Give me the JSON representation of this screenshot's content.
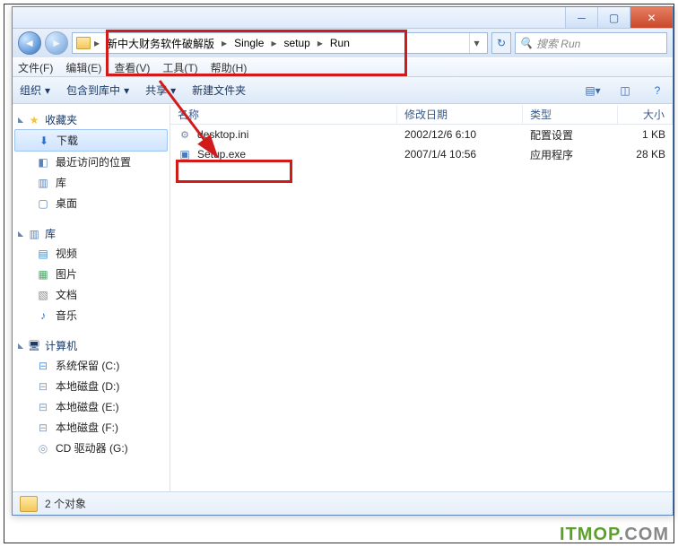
{
  "breadcrumbs": [
    "新中大财务软件破解版",
    "Single",
    "setup",
    "Run"
  ],
  "search": {
    "placeholder": "搜索 Run"
  },
  "menus": {
    "file": "文件(F)",
    "edit": "编辑(E)",
    "view": "查看(V)",
    "tools": "工具(T)",
    "help": "帮助(H)"
  },
  "toolbar": {
    "organize": "组织",
    "include": "包含到库中",
    "share": "共享",
    "newfolder": "新建文件夹"
  },
  "columns": {
    "name": "名称",
    "date": "修改日期",
    "type": "类型",
    "size": "大小"
  },
  "sidebar": {
    "fav": "收藏夹",
    "downloads": "下载",
    "recent": "最近访问的位置",
    "libhead": "库",
    "desktop": "桌面",
    "lib2": "库",
    "video": "视频",
    "pictures": "图片",
    "docs": "文档",
    "music": "音乐",
    "computer": "计算机",
    "drive_c": "系统保留 (C:)",
    "drive_d": "本地磁盘 (D:)",
    "drive_e": "本地磁盘 (E:)",
    "drive_f": "本地磁盘 (F:)",
    "drive_g": "CD 驱动器 (G:)"
  },
  "files": [
    {
      "name": "desktop.ini",
      "date": "2002/12/6 6:10",
      "type": "配置设置",
      "size": "1 KB"
    },
    {
      "name": "Setup.exe",
      "date": "2007/1/4 10:56",
      "type": "应用程序",
      "size": "28 KB"
    }
  ],
  "status": {
    "count": "2 个对象"
  },
  "watermark": {
    "a": "ITMOP",
    "b": ".COM"
  }
}
